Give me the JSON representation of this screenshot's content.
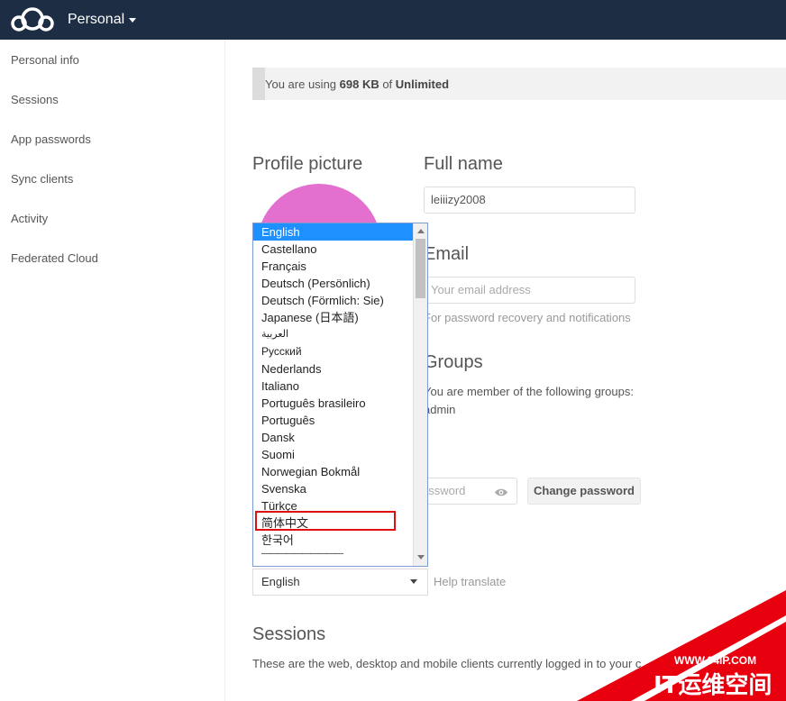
{
  "header": {
    "app_title": "Personal",
    "logo_icon": "cloud-logo-icon",
    "menu_icon": "caret-down-icon"
  },
  "sidebar": {
    "items": [
      {
        "label": "Personal info"
      },
      {
        "label": "Sessions"
      },
      {
        "label": "App passwords"
      },
      {
        "label": "Sync clients"
      },
      {
        "label": "Activity"
      },
      {
        "label": "Federated Cloud"
      }
    ]
  },
  "quota": {
    "prefix": "You are using ",
    "used": "698 KB",
    "middle": " of ",
    "total": "Unlimited"
  },
  "profile": {
    "picture_heading": "Profile picture",
    "avatar_color": "#e36fcf"
  },
  "fullname": {
    "heading": "Full name",
    "value": "leiiizy2008"
  },
  "email": {
    "heading": "Email",
    "placeholder": "Your email address",
    "hint": "For password recovery and notifications"
  },
  "groups": {
    "heading": "Groups",
    "text": "You are member of the following groups:",
    "group": "admin"
  },
  "password": {
    "placeholder": "assword",
    "eye_icon": "eye-icon",
    "change_button": "Change password"
  },
  "language": {
    "options": [
      "English",
      "Castellano",
      "Français",
      "Deutsch (Persönlich)",
      "Deutsch (Förmlich: Sie)",
      "Japanese (日本語)",
      "العربية",
      "Русский",
      "Nederlands",
      "Italiano",
      "Português brasileiro",
      "Português",
      "Dansk",
      "Suomi",
      "Norwegian Bokmål",
      "Svenska",
      "Türkçe",
      "简体中文",
      "한국어",
      "——————————"
    ],
    "selected": "English",
    "help_translate": "Help translate",
    "highlight_color": "#dd1111"
  },
  "sessions": {
    "heading": "Sessions",
    "text": "These are the web, desktop and mobile clients currently logged in to your c"
  },
  "watermark": {
    "url": "WWW.94IP.COM",
    "brand": "IT运维空间",
    "color": "#e8000f"
  }
}
